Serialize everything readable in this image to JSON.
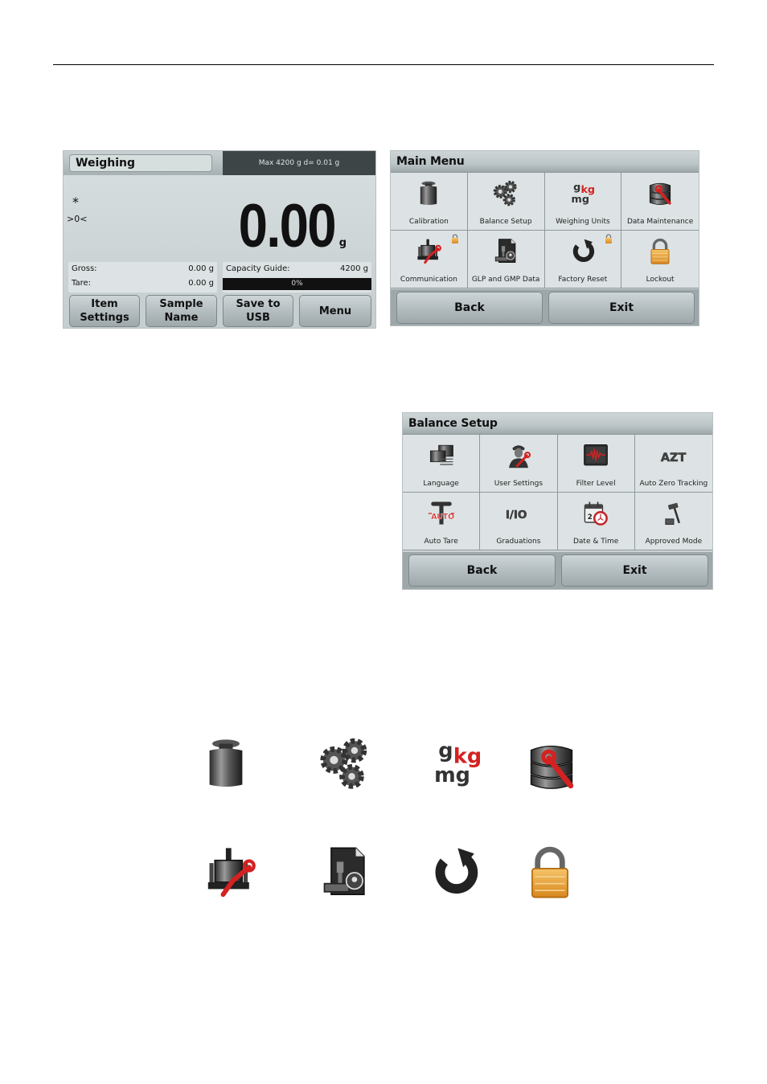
{
  "weighing_screen": {
    "title": "Weighing",
    "info": "Max 4200 g   d= 0.01 g",
    "stable_indicator": "*",
    "center_zero_indicator": ">0<",
    "reading": "0.00",
    "unit": "g",
    "gross_label": "Gross:",
    "gross_value": "0.00 g",
    "tare_label": "Tare:",
    "tare_value": "0.00 g",
    "capacity_label": "Capacity Guide:",
    "capacity_value": "4200 g",
    "capacity_percent_text": "0%",
    "capacity_fraction": 0,
    "buttons": [
      {
        "line1": "Item",
        "line2": "Settings"
      },
      {
        "line1": "Sample",
        "line2": "Name"
      },
      {
        "line1": "Save to",
        "line2": "USB"
      },
      {
        "line1": "Menu",
        "line2": ""
      }
    ]
  },
  "main_menu": {
    "title": "Main Menu",
    "items": [
      {
        "label": "Calibration",
        "icon": "calibration-weight-icon",
        "locked": false
      },
      {
        "label": "Balance Setup",
        "icon": "gears-icon",
        "locked": false
      },
      {
        "label": "Weighing Units",
        "icon": "units-icon",
        "locked": false
      },
      {
        "label": "Data Maintenance",
        "icon": "database-wrench-icon",
        "locked": false
      },
      {
        "label": "Communication",
        "icon": "connector-wrench-icon",
        "locked": true
      },
      {
        "label": "GLP and GMP Data",
        "icon": "document-stamp-icon",
        "locked": false
      },
      {
        "label": "Factory Reset",
        "icon": "reset-arrow-icon",
        "locked": true
      },
      {
        "label": "Lockout",
        "icon": "padlock-icon",
        "locked": false
      }
    ],
    "back_label": "Back",
    "exit_label": "Exit"
  },
  "balance_setup": {
    "title": "Balance Setup",
    "items": [
      {
        "label": "Language",
        "icon": "language-icon"
      },
      {
        "label": "User Settings",
        "icon": "user-wrench-icon"
      },
      {
        "label": "Filter Level",
        "icon": "filter-wave-icon"
      },
      {
        "label": "Auto Zero Tracking",
        "icon": "azt-icon"
      },
      {
        "label": "Auto Tare",
        "icon": "auto-tare-icon"
      },
      {
        "label": "Graduations",
        "icon": "graduations-icon"
      },
      {
        "label": "Date & Time",
        "icon": "calendar-clock-icon"
      },
      {
        "label": "Approved Mode",
        "icon": "gavel-icon"
      }
    ],
    "back_label": "Back",
    "exit_label": "Exit"
  },
  "icon_legend": {
    "units_glyphs": {
      "g": "g",
      "kg": "kg",
      "mg": "mg"
    },
    "azt_text": "AZT",
    "graduations_text": "I/IO",
    "auto_text": "AUTO",
    "calendar_day": "2"
  },
  "colors": {
    "accent_red": "#d42121",
    "lock_gold": "#e8a33a",
    "info_bar": "#3e4546",
    "screen_bg": "#d5dcdd"
  }
}
